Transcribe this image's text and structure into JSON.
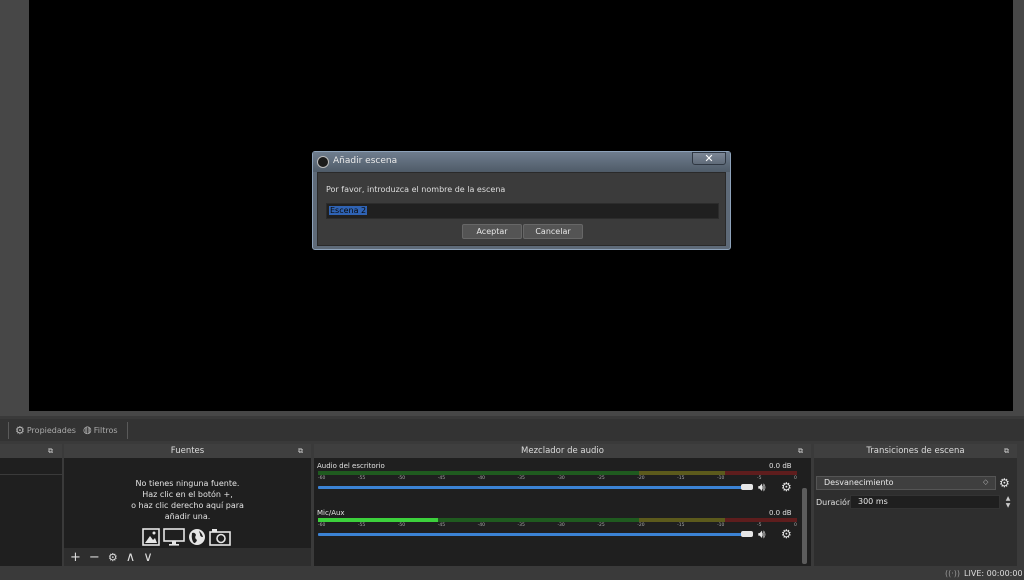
{
  "dialog": {
    "title": "Añadir escena",
    "close_label": "✕",
    "prompt": "Por favor, introduzca el nombre de la escena",
    "input_value": "Escena 2",
    "accept_label": "Aceptar",
    "cancel_label": "Cancelar"
  },
  "toolbar": {
    "properties_label": "Propiedades",
    "filters_label": "Filtros"
  },
  "sources": {
    "title": "Fuentes",
    "empty_line1": "No tienes ninguna fuente.",
    "empty_line2": "Haz clic en el botón +,",
    "empty_line3": "o haz clic derecho aquí para",
    "empty_line4": "añadir una.",
    "icons": [
      "image-icon",
      "display-icon",
      "globe-icon",
      "camera-icon"
    ],
    "footer_icons": [
      "plus-icon",
      "minus-icon",
      "gear-icon",
      "up-icon",
      "down-icon"
    ]
  },
  "mixer": {
    "title": "Mezclador de audio",
    "scale_ticks": [
      "-60",
      "-55",
      "-50",
      "-45",
      "-40",
      "-35",
      "-30",
      "-25",
      "-20",
      "-15",
      "-10",
      "-5",
      "0"
    ],
    "channels": [
      {
        "name": "Audio del escritorio",
        "db": "0.0 dB",
        "level": 0.0
      },
      {
        "name": "Mic/Aux",
        "db": "0.0 dB",
        "level": 0.25
      }
    ]
  },
  "transitions": {
    "title": "Transiciones de escena",
    "selected": "Desvanecimiento",
    "duration_label": "Duración",
    "duration_value": "300 ms"
  },
  "status": {
    "live": "LIVE: 00:00:00"
  },
  "colors": {
    "accent": "#3b82d4",
    "selection": "#2f63b4"
  }
}
